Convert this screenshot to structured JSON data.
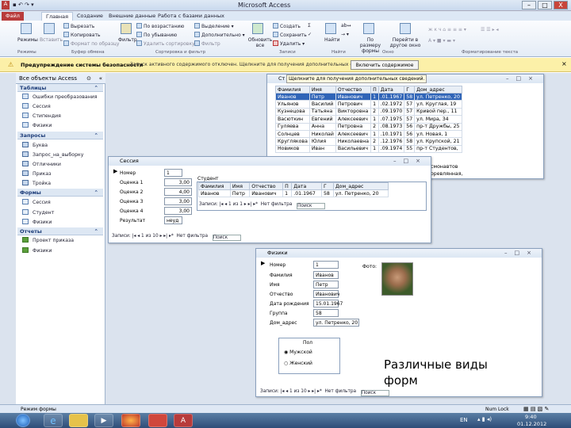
{
  "app": {
    "title": "Microsoft Access",
    "status_left": "Режим формы",
    "status_right": "Num Lock"
  },
  "window_buttons": [
    "–",
    "□",
    "X"
  ],
  "tabs": [
    "Файл",
    "Главная",
    "Создание",
    "Внешние данные",
    "Работа с базами данных"
  ],
  "ribbon": {
    "view": "Режимы",
    "paste": "Вставить",
    "cut": "Вырезать",
    "copy": "Копировать",
    "format_painter": "Формат по образцу",
    "filter": "Фильтр",
    "asc": "По возрастанию",
    "desc": "По убыванию",
    "remove_sort": "Удалить сортировку",
    "selection": "Выделение",
    "advanced": "Дополнительно",
    "toggle_filter": "Фильтр",
    "refresh": "Обновить все",
    "new": "Создать",
    "save": "Сохранить",
    "delete": "Удалить",
    "find": "Найти",
    "size": "По размеру формы",
    "switch": "Перейти в другое окно",
    "groups": [
      "Режимы",
      "Буфер обмена",
      "Сортировка и фильтр",
      "Записи",
      "Найти",
      "Окно",
      "Форматирование текста"
    ]
  },
  "security": {
    "title": "Предупреждение системы безопасности",
    "text": "Запуск активного содержимого отключен. Щелкните для получения дополнительных сведений.",
    "button": "Включить содержимое"
  },
  "nav": {
    "header": "Все объекты Access",
    "sections": [
      {
        "title": "Таблицы",
        "items": [
          "Ошибки преобразования",
          "Сессия",
          "Стипендия",
          "Физики"
        ]
      },
      {
        "title": "Запросы",
        "items": [
          "Буква",
          "Запрос_на_выборку",
          "Отличники",
          "Приказ",
          "Тройка"
        ]
      },
      {
        "title": "Формы",
        "items": [
          "Сессия",
          "Студент",
          "Физики"
        ]
      },
      {
        "title": "Отчеты",
        "items": [
          "Проект приказа",
          "Физики"
        ]
      }
    ]
  },
  "table_window": {
    "title_short": "Ст",
    "tooltip": "Щелкните для получения дополнительных сведений.",
    "columns": [
      "Фамилия",
      "Имя",
      "Отчество",
      "П",
      "Дата",
      "Г",
      "Дом_адрес"
    ],
    "rows": [
      [
        "Иванов",
        "Петр",
        "Иванович",
        "1",
        ".01.1967",
        "58",
        "ул. Петренко, 20"
      ],
      [
        "Ульянов",
        "Василий",
        "Петрович",
        "1",
        ".02.1972",
        "57",
        "ул. Круглая, 19"
      ],
      [
        "Кузнецова",
        "Татьяна",
        "Викторовна",
        "2",
        ".09.1970",
        "57",
        "Кривой пер., 11"
      ],
      [
        "Васюткин",
        "Евгений",
        "Алексеевич",
        "1",
        ".07.1975",
        "57",
        "ул. Мира, 34"
      ],
      [
        "Гуляева",
        "Анна",
        "Петровна",
        "2",
        ".08.1973",
        "56",
        "пр-т Дружбы, 25"
      ],
      [
        "Солнцев",
        "Николай",
        "Алексеевич",
        "1",
        ".10.1971",
        "56",
        "ул. Новая, 1"
      ],
      [
        "Круглякова",
        "Юлия",
        "Николаевна",
        "2",
        ".12.1976",
        "58",
        "ул. Крупской, 21"
      ],
      [
        "Новиков",
        "Иван",
        "Васильевич",
        "1",
        ".09.1974",
        "55",
        "пр-т Студентов,"
      ]
    ],
    "overflow_rows": [
      "смонавтов",
      "оревлянная,"
    ]
  },
  "session_form": {
    "title": "Сессия",
    "labels": [
      "Номер",
      "Оценка 1",
      "Оценка 2",
      "Оценка 3",
      "Оценка 4",
      "Результат"
    ],
    "values": [
      "1",
      "3,00",
      "4,00",
      "3,00",
      "3,00",
      "неуд"
    ],
    "sub_title": "Студент",
    "sub_columns": [
      "Фамилия",
      "Имя",
      "Отчество",
      "П",
      "Дата",
      "Г",
      "Дом_адрес"
    ],
    "sub_row": [
      "Иванов",
      "Петр",
      "Иванович",
      "1",
      ".01.1967",
      "58",
      "ул. Петренко, 20"
    ],
    "sub_nav": {
      "label": "Записи:",
      "pos": "1 из 1",
      "filter": "Нет фильтра",
      "search": "Поиск"
    },
    "nav": {
      "label": "Записи:",
      "pos": "1 из 10",
      "filter": "Нет фильтра",
      "search": "Поиск"
    }
  },
  "physics_form": {
    "title": "Физики",
    "labels": [
      "Номер",
      "Фамилия",
      "Имя",
      "Отчество",
      "Дата рождения",
      "Группа",
      "Дом_адрес"
    ],
    "values": [
      "1",
      "Иванов",
      "Петр",
      "Иванович",
      "15.01.1967",
      "58",
      "ул. Петренко, 20"
    ],
    "photo_label": "Фото:",
    "gender_title": "Пол",
    "gender_options": [
      "Мужской",
      "Женский"
    ],
    "nav": {
      "label": "Записи:",
      "pos": "1 из 10",
      "filter": "Нет фильтра",
      "search": "Поиск"
    }
  },
  "caption": {
    "line1": "Различные виды",
    "line2": "форм"
  },
  "taskbar": {
    "lang": "EN",
    "time": "9:40",
    "date": "01.12.2012"
  }
}
